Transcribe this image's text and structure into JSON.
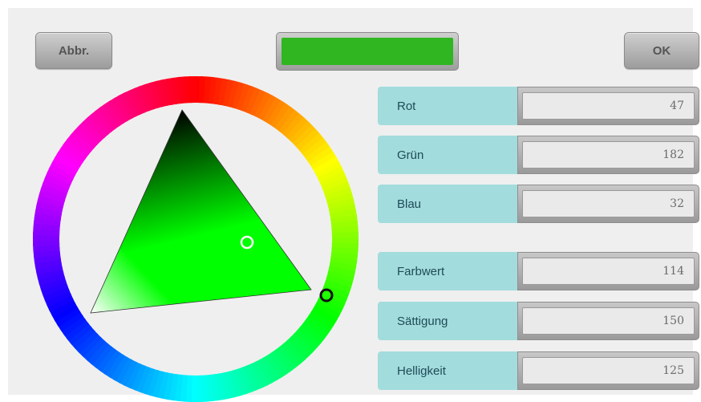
{
  "buttons": {
    "cancel": "Abbr.",
    "ok": "OK"
  },
  "preview_color": "#2fb620",
  "fields": [
    {
      "label": "Rot",
      "value": "47"
    },
    {
      "label": "Grün",
      "value": "182"
    },
    {
      "label": "Blau",
      "value": "32"
    },
    {
      "label": "Farbwert",
      "value": "114"
    },
    {
      "label": "Sättigung",
      "value": "150"
    },
    {
      "label": "Helligkeit",
      "value": "125"
    }
  ],
  "colors": {
    "label_bg": "#a3dcdd",
    "label_text": "#1e4c58",
    "dialog_bg": "#efefef"
  },
  "wheel": {
    "hue_deg": 114,
    "selected_hue_color": "#00ff00",
    "icons": [
      "hue-handle-icon",
      "sv-handle-icon"
    ]
  }
}
